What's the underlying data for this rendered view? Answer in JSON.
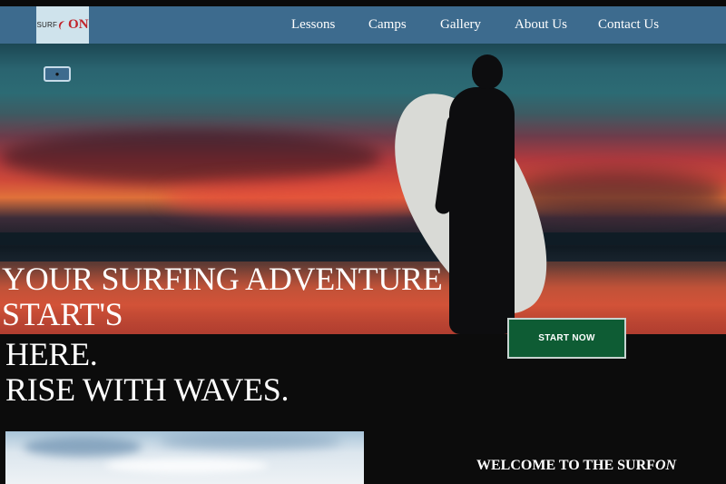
{
  "brand": {
    "logo_surf": "SURF",
    "logo_on": "ON",
    "colors": {
      "navbar": "#3d6b8e",
      "logo_bg": "#cfe3ec",
      "logo_accent": "#c0242b",
      "cta": "#0e5c34"
    }
  },
  "nav": {
    "items": [
      {
        "label": "Lessons"
      },
      {
        "label": "Camps"
      },
      {
        "label": "Gallery"
      },
      {
        "label": "About Us"
      },
      {
        "label": "Contact Us"
      }
    ]
  },
  "hero": {
    "toggle_icon": "sun-icon",
    "headline": {
      "line1": "YOUR SURFING ADVENTURE",
      "line2": "START'S",
      "line3": "HERE.",
      "line4": "RISE WITH WAVES."
    },
    "cta_label": "START NOW"
  },
  "welcome": {
    "prefix": "WELCOME TO THE SURF",
    "emphasis": "ON"
  }
}
